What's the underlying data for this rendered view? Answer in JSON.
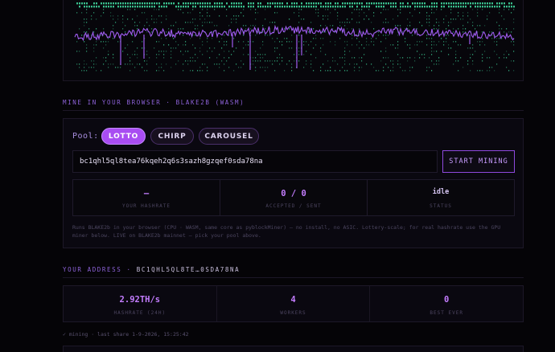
{
  "miner": {
    "section_title": "MINE IN YOUR BROWSER · BLAKE2B (WASM)",
    "pool_label": "Pool:",
    "pools": [
      {
        "label": "LOTTO",
        "active": true
      },
      {
        "label": "CHIRP",
        "active": false
      },
      {
        "label": "CAROUSEL",
        "active": false
      }
    ],
    "address_value": "bc1qhl5ql8tea76kqeh2q6s3sazh8gzqef0sda78na",
    "start_label": "START MINING",
    "stats": [
      {
        "value": "–",
        "label": "YOUR HASHRATE"
      },
      {
        "value": "0 / 0",
        "label": "ACCEPTED / SENT"
      },
      {
        "value": "idle",
        "label": "STATUS"
      }
    ],
    "note": "Runs BLAKE2b in your browser (CPU · WASM, same core as pyblockMiner) — no install, no ASIC. Lottery-scale; for real hashrate use the GPU miner below. LIVE on BLAKE2b mainnet — pick your pool above."
  },
  "address_section": {
    "title_prefix": "YOUR ADDRESS",
    "separator": "·",
    "address_short": "BC1QHL5QL8TE…0SDA78NA"
  },
  "summary": [
    {
      "value": "2.92TH/s",
      "label": "HASHRATE (24H)"
    },
    {
      "value": "4",
      "label": "WORKERS"
    },
    {
      "value": "0",
      "label": "BEST EVER"
    }
  ],
  "status_line": "✓ mining · last share 1-9-2026, 15:25:42",
  "colors": {
    "accent": "#a94df2",
    "accent_text": "#c47dff",
    "line": "#a05cf0",
    "dots": "#3fd49a",
    "background": "#050407"
  }
}
